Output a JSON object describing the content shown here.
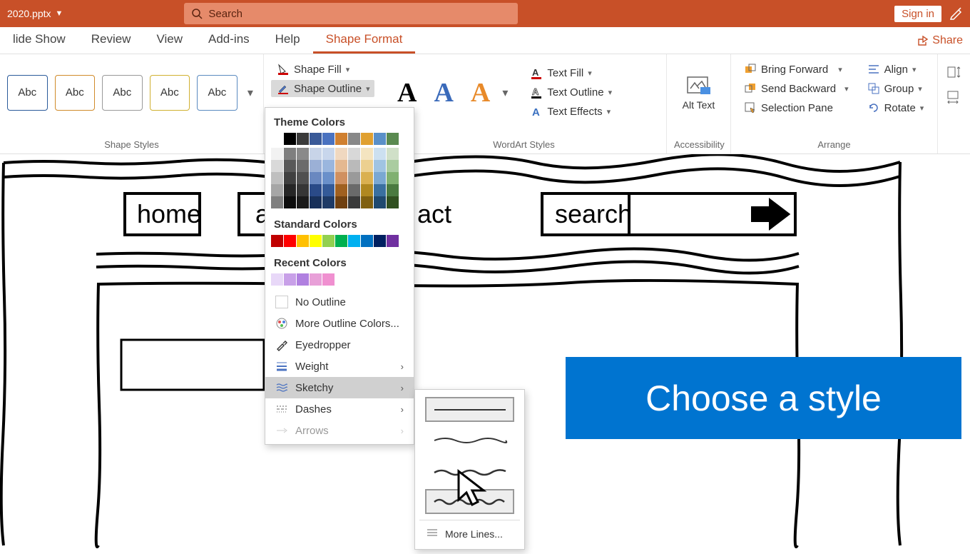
{
  "titlebar": {
    "filename": "2020.pptx",
    "search_placeholder": "Search",
    "signin": "Sign in"
  },
  "tabs": {
    "t0": "lide Show",
    "t1": "Review",
    "t2": "View",
    "t3": "Add-ins",
    "t4": "Help",
    "t5": "Shape Format",
    "share": "Share"
  },
  "ribbon": {
    "abc": "Abc",
    "groups": {
      "shape_styles": "Shape Styles",
      "wordart": "WordArt Styles",
      "access": "Accessibility",
      "arrange": "Arrange"
    },
    "shape_fill": "Shape Fill",
    "shape_outline": "Shape Outline",
    "text_fill": "Text Fill",
    "text_outline": "Text Outline",
    "text_effects": "Text Effects",
    "alt_text": "Alt Text",
    "bring_forward": "Bring Forward",
    "send_backward": "Send Backward",
    "selection_pane": "Selection Pane",
    "align": "Align",
    "group": "Group",
    "rotate": "Rotate"
  },
  "colors": {
    "theme_label": "Theme Colors",
    "theme_row": [
      "#ffffff",
      "#000000",
      "#3b3b3b",
      "#3a5a98",
      "#4a72c0",
      "#d08030",
      "#888888",
      "#e0a030",
      "#5a90c8",
      "#5a8a50"
    ],
    "shades": [
      [
        "#f2f2f2",
        "#d9d9d9",
        "#bfbfbf",
        "#a6a6a6",
        "#808080"
      ],
      [
        "#7f7f7f",
        "#595959",
        "#404040",
        "#262626",
        "#0d0d0d"
      ],
      [
        "#8a8a8a",
        "#6b6b6b",
        "#505050",
        "#363636",
        "#1a1a1a"
      ],
      [
        "#c8d4e8",
        "#9bb0d6",
        "#6a88c0",
        "#2a4a88",
        "#18305a"
      ],
      [
        "#c8d6ec",
        "#9ab6de",
        "#6a90ca",
        "#345a98",
        "#1e3a66"
      ],
      [
        "#f0d8c0",
        "#e4b890",
        "#d09060",
        "#a06020",
        "#704010"
      ],
      [
        "#d8d8d8",
        "#bababa",
        "#9a9a9a",
        "#6a6a6a",
        "#3a3a3a"
      ],
      [
        "#f4e4c0",
        "#ecd090",
        "#dab050",
        "#b08820",
        "#806010"
      ],
      [
        "#cce0f0",
        "#a0c4e2",
        "#7aa8d2",
        "#3a70a0",
        "#204a70"
      ],
      [
        "#d0e0c8",
        "#aacca0",
        "#80b070",
        "#4a7a40",
        "#305020"
      ]
    ],
    "standard_label": "Standard Colors",
    "standard": [
      "#c00000",
      "#ff0000",
      "#ffc000",
      "#ffff00",
      "#92d050",
      "#00b050",
      "#00b0f0",
      "#0070c0",
      "#002060",
      "#7030a0"
    ],
    "recent_label": "Recent Colors",
    "recent": [
      "#e8d8f8",
      "#c8a0e8",
      "#b080e0",
      "#e8a0d8",
      "#f090d0"
    ]
  },
  "dropdown": {
    "no_outline": "No Outline",
    "more_colors": "More Outline Colors...",
    "eyedropper": "Eyedropper",
    "weight": "Weight",
    "sketchy": "Sketchy",
    "dashes": "Dashes",
    "arrows": "Arrows"
  },
  "sketchy_menu": {
    "more": "More Lines..."
  },
  "slide": {
    "home": "home",
    "about_partial": "a",
    "contact_partial": "act",
    "search": "search"
  },
  "hint": "Choose a style"
}
